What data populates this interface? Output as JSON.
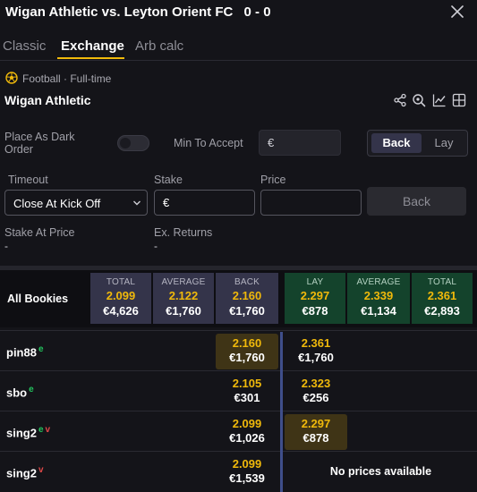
{
  "header": {
    "title": "Wigan Athletic vs. Leyton Orient FC",
    "score": "0 - 0"
  },
  "tabs": [
    {
      "label": "Classic"
    },
    {
      "label": "Exchange"
    },
    {
      "label": "Arb calc"
    }
  ],
  "event": {
    "meta": "Football · Full-time",
    "selection": "Wigan Athletic"
  },
  "form": {
    "dark_order_label": "Place As Dark Order",
    "min_accept_label": "Min To Accept",
    "currency": "€",
    "side_back": "Back",
    "side_lay": "Lay",
    "timeout_label": "Timeout",
    "timeout_value": "Close At Kick Off",
    "stake_label": "Stake",
    "price_label": "Price",
    "submit_label": "Back",
    "stake_at_price_label": "Stake At Price",
    "stake_at_price_value": "-",
    "ex_returns_label": "Ex. Returns",
    "ex_returns_value": "-"
  },
  "summary": {
    "label": "All Bookies",
    "cols": [
      {
        "head": "TOTAL",
        "price": "2.099",
        "stake": "€4,626",
        "side": "back"
      },
      {
        "head": "AVERAGE",
        "price": "2.122",
        "stake": "€1,760",
        "side": "back"
      },
      {
        "head": "BACK",
        "price": "2.160",
        "stake": "€1,760",
        "side": "back"
      },
      {
        "head": "LAY",
        "price": "2.297",
        "stake": "€878",
        "side": "lay"
      },
      {
        "head": "AVERAGE",
        "price": "2.339",
        "stake": "€1,134",
        "side": "lay"
      },
      {
        "head": "TOTAL",
        "price": "2.361",
        "stake": "€2,893",
        "side": "lay"
      }
    ]
  },
  "bookies": [
    {
      "name": "pin88",
      "tags": [
        "e"
      ],
      "back": {
        "price": "2.160",
        "stake": "€1,760"
      },
      "lay": {
        "price": "2.361",
        "stake": "€1,760"
      }
    },
    {
      "name": "sbo",
      "tags": [
        "e"
      ],
      "back": {
        "price": "2.105",
        "stake": "€301"
      },
      "lay": {
        "price": "2.323",
        "stake": "€256"
      }
    },
    {
      "name": "sing2",
      "tags": [
        "e",
        "v"
      ],
      "back": {
        "price": "2.099",
        "stake": "€1,026"
      },
      "lay": {
        "price": "2.297",
        "stake": "€878"
      }
    },
    {
      "name": "sing2",
      "tags": [
        "v"
      ],
      "back": {
        "price": "2.099",
        "stake": "€1,539"
      },
      "lay": null
    }
  ],
  "no_prices_text": "No prices available",
  "colors": {
    "accent": "#f0b90b",
    "back_col": "#34344a",
    "lay_col": "#14432c",
    "highlight": "#3f3416",
    "exchange_tag": "#22c55e",
    "verified_tag": "#e04848"
  },
  "icons": [
    "close-icon",
    "football-icon",
    "share-icon",
    "zoom-icon",
    "chart-icon",
    "grid-icon",
    "chevron-down-icon"
  ]
}
